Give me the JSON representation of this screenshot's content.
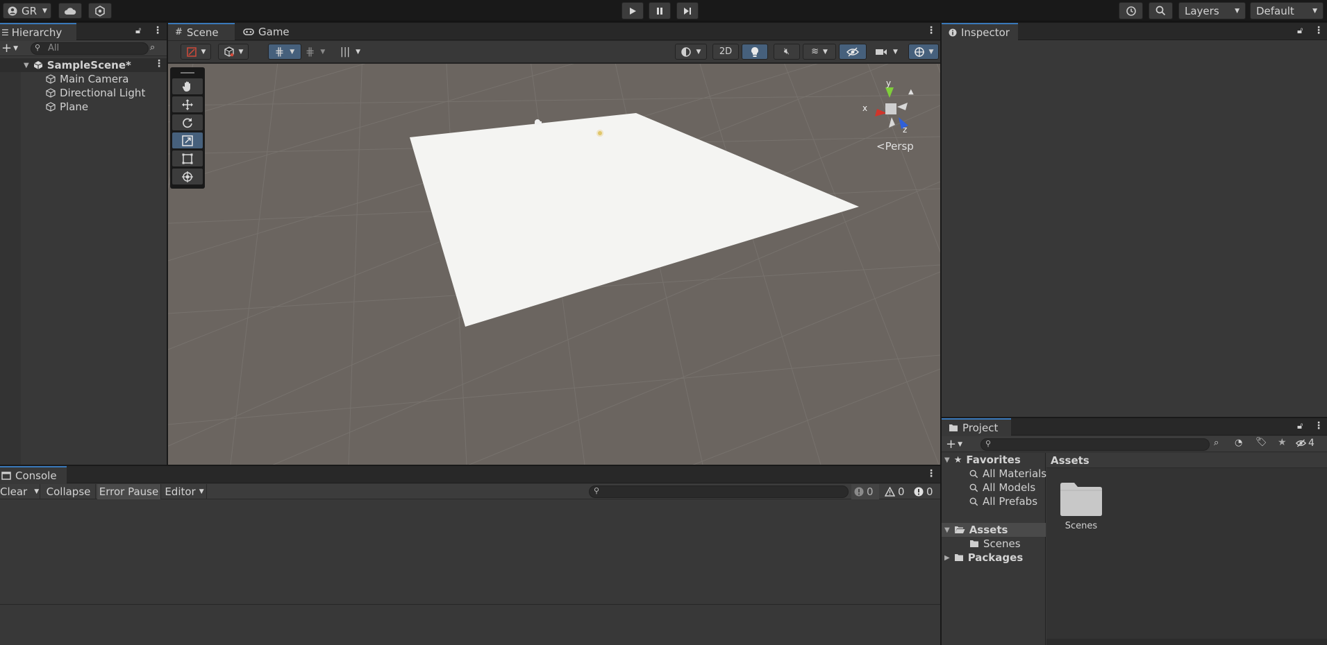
{
  "colors": {
    "accent": "#3a79bb",
    "editor_bg": "#191919",
    "panel_bg": "#383838",
    "tab_strip": "#282828",
    "scene_bg": "#6b6560",
    "plane": "#f4f4f2",
    "gizmo_x": "#d0352b",
    "gizmo_y": "#7fcf3a",
    "gizmo_z": "#3060d8"
  },
  "topbar": {
    "account_label": "GR",
    "account_icon": "user-circle-icon",
    "cloud_icon": "cloud-icon",
    "collab_icon": "collab-icon",
    "play_icon": "play-icon",
    "pause_icon": "pause-icon",
    "step_icon": "step-icon",
    "history_icon": "history-icon",
    "search_icon": "search-icon",
    "layers_label": "Layers",
    "layout_label": "Default"
  },
  "hierarchy": {
    "tab_label": "Hierarchy",
    "search_placeholder": "All",
    "scene_name": "SampleScene*",
    "items": [
      {
        "label": "Main Camera"
      },
      {
        "label": "Directional Light"
      },
      {
        "label": "Plane"
      }
    ]
  },
  "scene": {
    "tab_scene": "Scene",
    "tab_game": "Game",
    "btn_2d": "2D",
    "persp_label": "<Persp",
    "axis_x": "x",
    "axis_y": "y",
    "axis_z": "z",
    "tools": [
      "hand-tool-icon",
      "move-tool-icon",
      "rotate-tool-icon",
      "scale-tool-icon",
      "rect-tool-icon",
      "transform-tool-icon"
    ],
    "active_tool": "scale-tool-icon"
  },
  "inspector": {
    "tab_label": "Inspector"
  },
  "project": {
    "tab_label": "Project",
    "hidden_count": "4",
    "favorites_label": "Favorites",
    "favorites": [
      {
        "label": "All Materials"
      },
      {
        "label": "All Models"
      },
      {
        "label": "All Prefabs"
      }
    ],
    "assets_label": "Assets",
    "assets_children": [
      {
        "label": "Scenes"
      }
    ],
    "packages_label": "Packages",
    "breadcrumb": "Assets",
    "grid_items": [
      {
        "label": "Scenes"
      }
    ]
  },
  "console": {
    "tab_label": "Console",
    "clear_label": "Clear",
    "collapse_label": "Collapse",
    "error_pause_label": "Error Pause",
    "editor_label": "Editor",
    "count_log": "0",
    "count_warn": "0",
    "count_error": "0"
  }
}
